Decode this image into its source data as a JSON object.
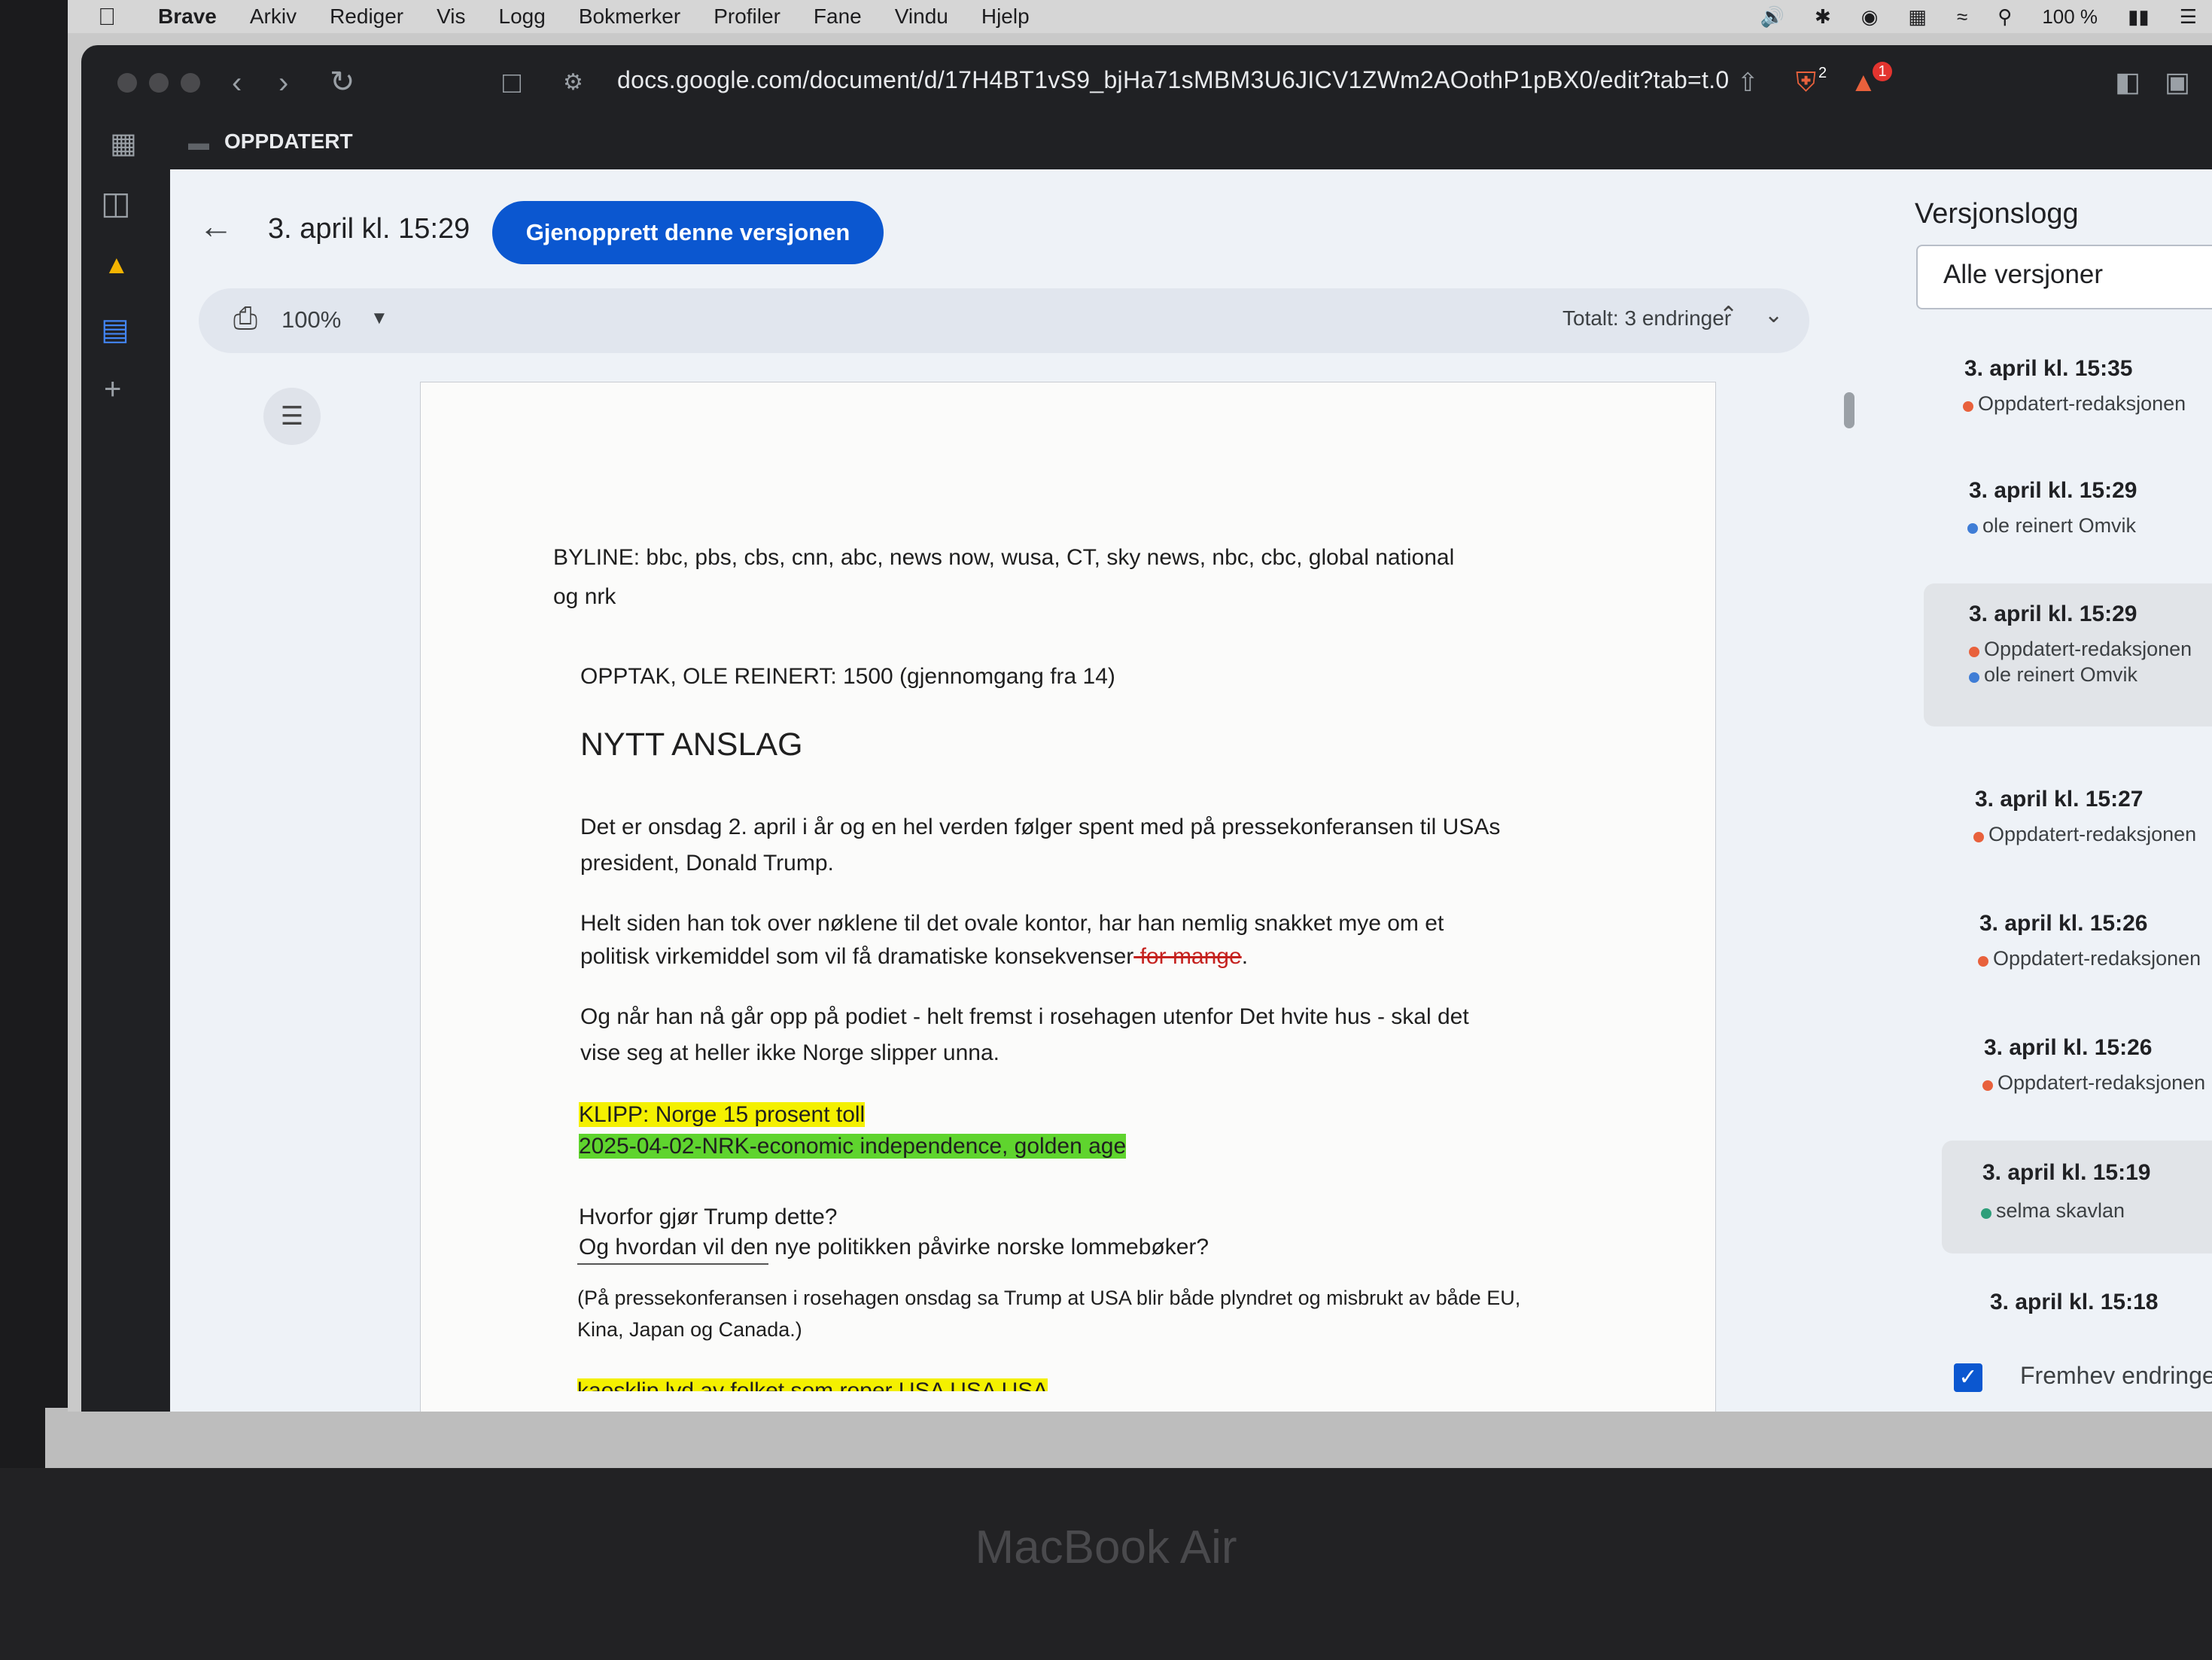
{
  "menubar": {
    "app": "Brave",
    "items": [
      "Arkiv",
      "Rediger",
      "Vis",
      "Logg",
      "Bokmerker",
      "Profiler",
      "Fane",
      "Vindu",
      "Hjelp"
    ],
    "battery": "100 %"
  },
  "browser": {
    "url": "docs.google.com/document/d/17H4BT1vS9_bjHa71sMBM3U6JICV1ZWm2AOothP1pBX0/edit?tab=t.0",
    "tab_title": "OPPDATERT",
    "shield_badge": "2",
    "alert_badge": "1"
  },
  "docs": {
    "version_title": "3. april kl. 15:29",
    "restore_button": "Gjenopprett denne versjonen",
    "zoom": "100%",
    "total_changes": "Totalt: 3 endringer",
    "page": {
      "byline_1": "BYLINE: bbc, pbs, cbs, cnn, abc, news now, wusa, CT, sky news, nbc, cbc, global national",
      "byline_2": "og nrk",
      "recording": "OPPTAK, OLE REINERT: 1500 (gjennomgang fra 14)",
      "heading": "NYTT ANSLAG",
      "para1_line1": "Det er onsdag 2. april i år og en hel verden følger spent med på pressekonferansen til USAs",
      "para1_line2": "president, Donald Trump.",
      "para2_line1": "Helt siden han tok over nøklene til det ovale kontor, har han nemlig snakket mye om et",
      "para2_line2": "politisk virkemiddel som vil få dramatiske konsekvenser",
      "para2_struck": " for mange",
      "para2_end": ".",
      "para3_line1": "Og når han nå går opp på podiet - helt fremst i rosehagen utenfor Det hvite hus - skal det",
      "para3_line2": "vise seg at heller ikke Norge slipper unna.",
      "clip_1": "KLIPP: Norge 15 prosent toll",
      "clip_2": "2025-04-02-NRK-economic independence, golden age",
      "question_1": "Hvorfor gjør Trump dette?",
      "question_2": "Og hvordan vil den nye politikken påvirke norske lommebøker?",
      "footnote_1": "(På pressekonferansen i rosehagen onsdag sa Trump at USA blir både plyndret og misbrukt av både EU,",
      "footnote_2": "Kina, Japan og Canada.)",
      "cut_off": "kaosklip lyd av folket som roper USA USA USA"
    }
  },
  "version_log": {
    "title": "Versjonslogg",
    "filter": "Alle versjoner",
    "versions": [
      {
        "time": "3. april kl. 15:35",
        "authors": [
          {
            "name": "Oppdatert-redaksjonen",
            "color": "#e8613c"
          }
        ]
      },
      {
        "time": "3. april kl. 15:29",
        "authors": [
          {
            "name": "ole reinert Omvik",
            "color": "#3f7dd6"
          }
        ]
      },
      {
        "time": "3. april kl. 15:29",
        "authors": [
          {
            "name": "Oppdatert-redaksjonen",
            "color": "#e8613c"
          },
          {
            "name": "ole reinert Omvik",
            "color": "#3f7dd6"
          }
        ]
      },
      {
        "time": "3. april kl. 15:27",
        "authors": [
          {
            "name": "Oppdatert-redaksjonen",
            "color": "#e8613c"
          }
        ]
      },
      {
        "time": "3. april kl. 15:26",
        "authors": [
          {
            "name": "Oppdatert-redaksjonen",
            "color": "#e8613c"
          }
        ]
      },
      {
        "time": "3. april kl. 15:26",
        "authors": [
          {
            "name": "Oppdatert-redaksjonen",
            "color": "#e8613c"
          }
        ]
      },
      {
        "time": "3. april kl. 15:19",
        "authors": [
          {
            "name": "selma skavlan",
            "color": "#2e9e7a"
          }
        ]
      },
      {
        "time": "3. april kl. 15:18",
        "authors": []
      }
    ],
    "highlight_changes": "Fremhev endringer"
  },
  "device_label": "MacBook Air"
}
